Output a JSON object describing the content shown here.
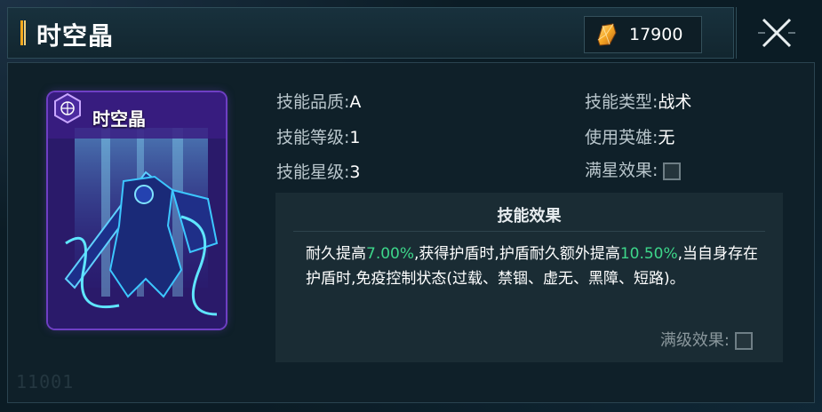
{
  "header": {
    "title": "时空晶",
    "currency_value": "17900",
    "currency_icon": "crystal-icon",
    "close_icon": "close-icon"
  },
  "card": {
    "name": "时空晶",
    "emblem_icon": "skill-emblem-icon"
  },
  "info": {
    "quality_label": "技能品质:",
    "quality_value": "A",
    "level_label": "技能等级:",
    "level_value": "1",
    "star_label": "技能星级:",
    "star_value": "3",
    "type_label": "技能类型:",
    "type_value": "战术",
    "hero_label": "使用英雄:",
    "hero_value": "无",
    "max_star_label": "满星效果:"
  },
  "effect": {
    "title": "技能效果",
    "text_1": "耐久提高",
    "hl_1": "7.00%",
    "text_2": ",获得护盾时,护盾耐久额外提高",
    "hl_2": "10.50%",
    "text_3": ",当自身存在护盾时,免疫控制状态(过载、禁锢、虚无、黑障、短路)。",
    "max_level_label": "满级效果:"
  },
  "watermark": "11001",
  "colors": {
    "highlight": "#3dd68a",
    "accent": "#f2a81d",
    "card_purple": "#5a2ea0"
  }
}
